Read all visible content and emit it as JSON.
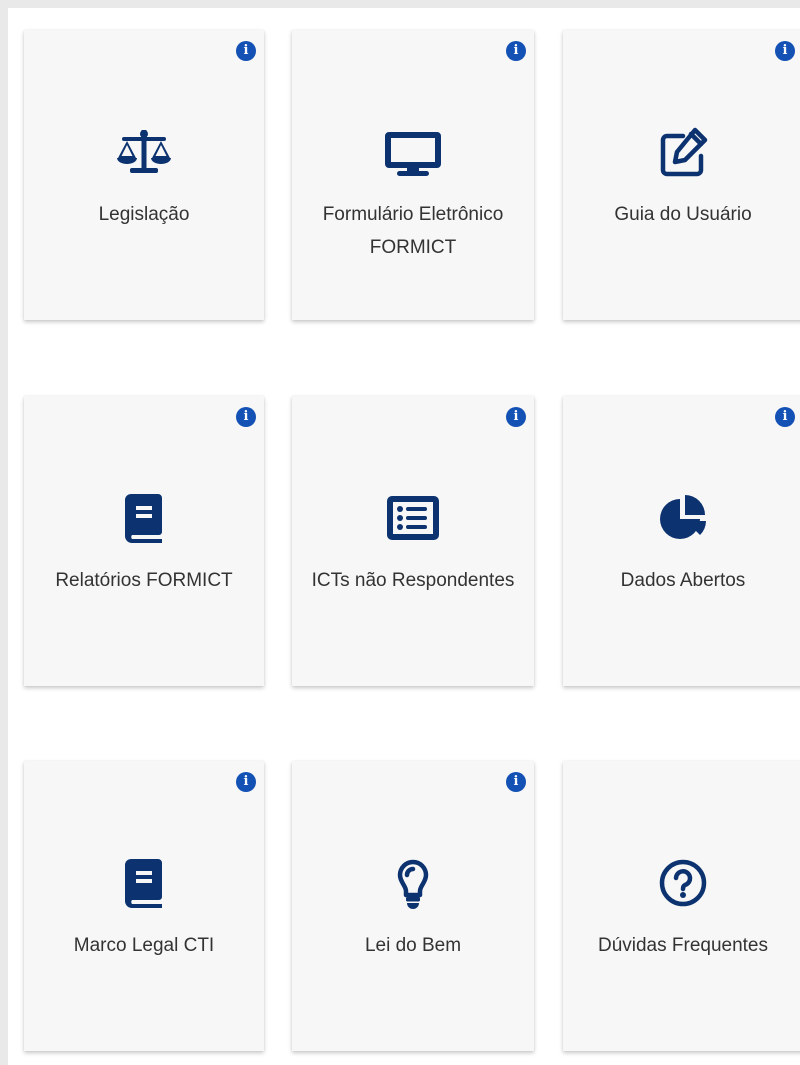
{
  "colors": {
    "icon": "#0c326f",
    "info_badge": "#1351b4",
    "card_bg": "#f7f7f7",
    "label_text": "#333333"
  },
  "cards": [
    {
      "label": "Legislação",
      "icon": "balance-scale-icon",
      "info": "i"
    },
    {
      "label": "Formulário Eletrônico FORMICT",
      "icon": "desktop-icon",
      "info": "i"
    },
    {
      "label": "Guia do Usuário",
      "icon": "edit-icon",
      "info": "i"
    },
    {
      "label": "Relatórios FORMICT",
      "icon": "book-icon",
      "info": "i"
    },
    {
      "label": "ICTs não Respondentes",
      "icon": "list-alt-icon",
      "info": "i"
    },
    {
      "label": "Dados Abertos",
      "icon": "pie-chart-icon",
      "info": "i"
    },
    {
      "label": "Marco Legal CTI",
      "icon": "book-icon",
      "info": "i"
    },
    {
      "label": "Lei do Bem",
      "icon": "lightbulb-icon",
      "info": "i"
    },
    {
      "label": "Dúvidas Frequentes",
      "icon": "question-circle-icon",
      "info": null
    }
  ]
}
